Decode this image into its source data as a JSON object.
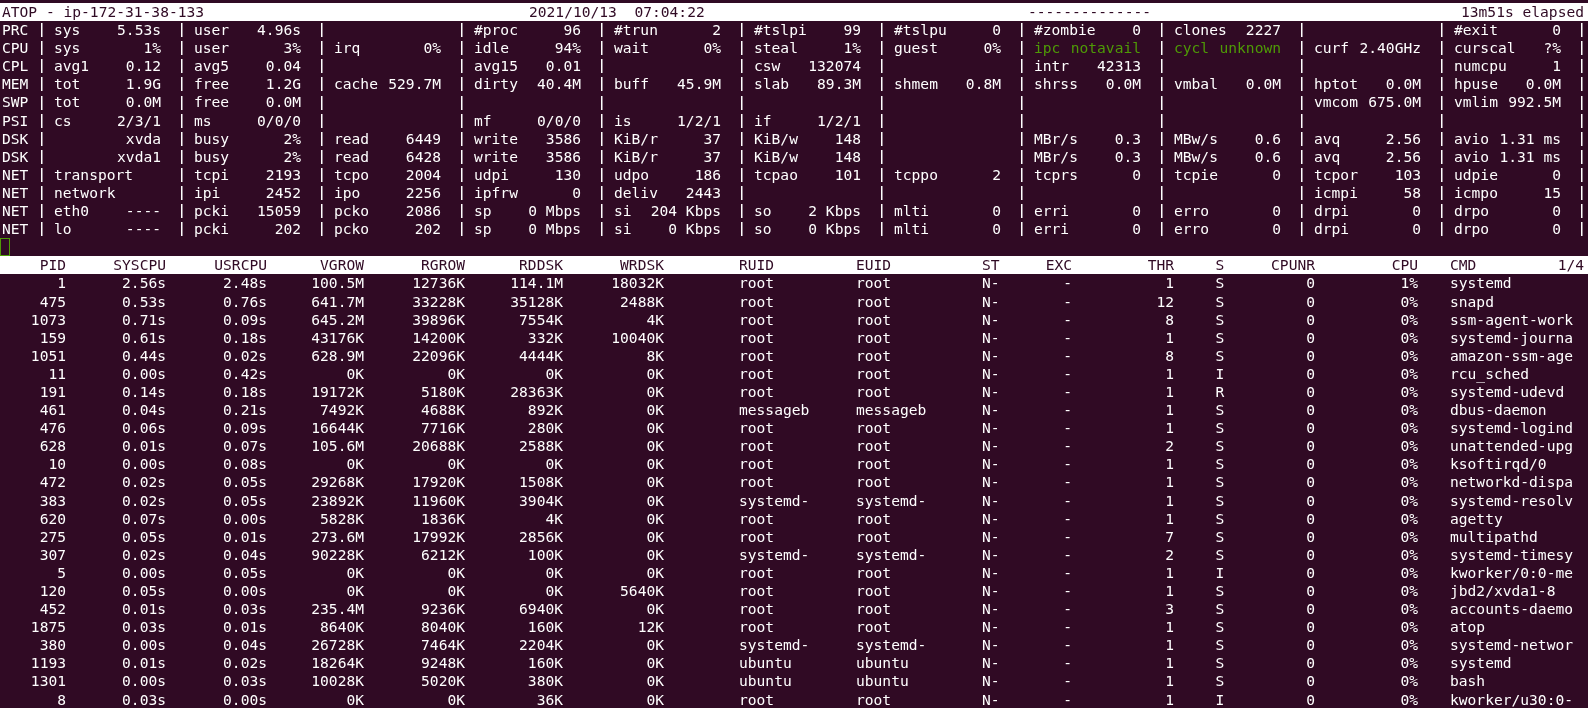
{
  "header": {
    "title": "ATOP - ip-172-31-38-133",
    "timestamp": "2021/10/13  07:04:22",
    "dashes": "--------------",
    "elapsed": "13m51s elapsed"
  },
  "system_stats": [
    {
      "label": "PRC",
      "cells": [
        {
          "k": "sys",
          "v": "5.53s"
        },
        {
          "k": "user",
          "v": "4.96s"
        },
        {},
        {
          "k": "#proc",
          "v": "96"
        },
        {
          "k": "#trun",
          "v": "2"
        },
        {
          "k": "#tslpi",
          "v": "99"
        },
        {
          "k": "#tslpu",
          "v": "0"
        },
        {
          "k": "#zombie",
          "v": "0"
        },
        {
          "k": "clones",
          "v": "2227"
        },
        {},
        {
          "k": "#exit",
          "v": "0"
        }
      ]
    },
    {
      "label": "CPU",
      "cells": [
        {
          "k": "sys",
          "v": "1%"
        },
        {
          "k": "user",
          "v": "3%"
        },
        {
          "k": "irq",
          "v": "0%"
        },
        {
          "k": "idle",
          "v": "94%"
        },
        {
          "k": "wait",
          "v": "0%"
        },
        {
          "k": "steal",
          "v": "1%"
        },
        {
          "k": "guest",
          "v": "0%"
        },
        {
          "k": "ipc",
          "v": "notavail",
          "color": "#4e9a06"
        },
        {
          "k": "cycl",
          "v": "unknown",
          "color": "#4e9a06"
        },
        {
          "k": "curf",
          "v": "2.40GHz"
        },
        {
          "k": "curscal",
          "v": "?%"
        }
      ]
    },
    {
      "label": "CPL",
      "cells": [
        {
          "k": "avg1",
          "v": "0.12"
        },
        {
          "k": "avg5",
          "v": "0.04"
        },
        {},
        {
          "k": "avg15",
          "v": "0.01"
        },
        {},
        {
          "k": "csw",
          "v": "132074"
        },
        {},
        {
          "k": "intr",
          "v": "42313"
        },
        {},
        {},
        {
          "k": "numcpu",
          "v": "1"
        }
      ]
    },
    {
      "label": "MEM",
      "cells": [
        {
          "k": "tot",
          "v": "1.9G"
        },
        {
          "k": "free",
          "v": "1.2G"
        },
        {
          "k": "cache",
          "v": "529.7M"
        },
        {
          "k": "dirty",
          "v": "40.4M"
        },
        {
          "k": "buff",
          "v": "45.9M"
        },
        {
          "k": "slab",
          "v": "89.3M"
        },
        {
          "k": "shmem",
          "v": "0.8M"
        },
        {
          "k": "shrss",
          "v": "0.0M"
        },
        {
          "k": "vmbal",
          "v": "0.0M"
        },
        {
          "k": "hptot",
          "v": "0.0M"
        },
        {
          "k": "hpuse",
          "v": "0.0M"
        }
      ]
    },
    {
      "label": "SWP",
      "cells": [
        {
          "k": "tot",
          "v": "0.0M"
        },
        {
          "k": "free",
          "v": "0.0M"
        },
        {},
        {},
        {},
        {},
        {},
        {},
        {},
        {
          "k": "vmcom",
          "v": "675.0M"
        },
        {
          "k": "vmlim",
          "v": "992.5M"
        }
      ]
    },
    {
      "label": "PSI",
      "cells": [
        {
          "k": "cs",
          "v": "2/3/1"
        },
        {
          "k": "ms",
          "v": "0/0/0"
        },
        {},
        {
          "k": "mf",
          "v": "0/0/0"
        },
        {
          "k": "is",
          "v": "1/2/1"
        },
        {
          "k": "if",
          "v": "1/2/1"
        },
        {},
        {},
        {},
        {},
        {}
      ]
    },
    {
      "label": "DSK",
      "cells": [
        {
          "v": "xvda"
        },
        {
          "k": "busy",
          "v": "2%"
        },
        {
          "k": "read",
          "v": "6449"
        },
        {
          "k": "write",
          "v": "3586"
        },
        {
          "k": "KiB/r",
          "v": "37"
        },
        {
          "k": "KiB/w",
          "v": "148"
        },
        {},
        {
          "k": "MBr/s",
          "v": "0.3"
        },
        {
          "k": "MBw/s",
          "v": "0.6"
        },
        {
          "k": "avq",
          "v": "2.56"
        },
        {
          "k": "avio",
          "v": "1.31 ms"
        }
      ]
    },
    {
      "label": "DSK",
      "cells": [
        {
          "v": "xvda1"
        },
        {
          "k": "busy",
          "v": "2%"
        },
        {
          "k": "read",
          "v": "6428"
        },
        {
          "k": "write",
          "v": "3586"
        },
        {
          "k": "KiB/r",
          "v": "37"
        },
        {
          "k": "KiB/w",
          "v": "148"
        },
        {},
        {
          "k": "MBr/s",
          "v": "0.3"
        },
        {
          "k": "MBw/s",
          "v": "0.6"
        },
        {
          "k": "avq",
          "v": "2.56"
        },
        {
          "k": "avio",
          "v": "1.31 ms"
        }
      ]
    },
    {
      "label": "NET",
      "cells": [
        {
          "k": "transport"
        },
        {
          "k": "tcpi",
          "v": "2193"
        },
        {
          "k": "tcpo",
          "v": "2004"
        },
        {
          "k": "udpi",
          "v": "130"
        },
        {
          "k": "udpo",
          "v": "186"
        },
        {
          "k": "tcpao",
          "v": "101"
        },
        {
          "k": "tcppo",
          "v": "2"
        },
        {
          "k": "tcprs",
          "v": "0"
        },
        {
          "k": "tcpie",
          "v": "0"
        },
        {
          "k": "tcpor",
          "v": "103"
        },
        {
          "k": "udpie",
          "v": "0"
        }
      ]
    },
    {
      "label": "NET",
      "cells": [
        {
          "k": "network"
        },
        {
          "k": "ipi",
          "v": "2452"
        },
        {
          "k": "ipo",
          "v": "2256"
        },
        {
          "k": "ipfrw",
          "v": "0"
        },
        {
          "k": "deliv",
          "v": "2443"
        },
        {},
        {},
        {},
        {},
        {
          "k": "icmpi",
          "v": "58"
        },
        {
          "k": "icmpo",
          "v": "15"
        }
      ]
    },
    {
      "label": "NET",
      "cells": [
        {
          "k": "eth0",
          "v": "----"
        },
        {
          "k": "pcki",
          "v": "15059"
        },
        {
          "k": "pcko",
          "v": "2086"
        },
        {
          "k": "sp",
          "v": "0 Mbps"
        },
        {
          "k": "si",
          "v": "204 Kbps"
        },
        {
          "k": "so",
          "v": "2 Kbps"
        },
        {
          "k": "mlti",
          "v": "0"
        },
        {
          "k": "erri",
          "v": "0"
        },
        {
          "k": "erro",
          "v": "0"
        },
        {
          "k": "drpi",
          "v": "0"
        },
        {
          "k": "drpo",
          "v": "0"
        }
      ]
    },
    {
      "label": "NET",
      "cells": [
        {
          "k": "lo",
          "v": "----"
        },
        {
          "k": "pcki",
          "v": "202"
        },
        {
          "k": "pcko",
          "v": "202"
        },
        {
          "k": "sp",
          "v": "0 Mbps"
        },
        {
          "k": "si",
          "v": "0 Kbps"
        },
        {
          "k": "so",
          "v": "0 Kbps"
        },
        {
          "k": "mlti",
          "v": "0"
        },
        {
          "k": "erri",
          "v": "0"
        },
        {
          "k": "erro",
          "v": "0"
        },
        {
          "k": "drpi",
          "v": "0"
        },
        {
          "k": "drpo",
          "v": "0"
        }
      ]
    }
  ],
  "process_table": {
    "columns": [
      "PID",
      "SYSCPU",
      "USRCPU",
      "VGROW",
      "RGROW",
      "RDDSK",
      "WRDSK",
      "RUID",
      "EUID",
      "ST",
      "EXC",
      "THR",
      "S",
      "CPUNR",
      "CPU",
      "CMD"
    ],
    "page": "1/4",
    "rows": [
      [
        "1",
        "2.56s",
        "2.48s",
        "100.5M",
        "12736K",
        "114.1M",
        "18032K",
        "root",
        "root",
        "N-",
        "-",
        "1",
        "S",
        "0",
        "1%",
        "systemd"
      ],
      [
        "475",
        "0.53s",
        "0.76s",
        "641.7M",
        "33228K",
        "35128K",
        "2488K",
        "root",
        "root",
        "N-",
        "-",
        "12",
        "S",
        "0",
        "0%",
        "snapd"
      ],
      [
        "1073",
        "0.71s",
        "0.09s",
        "645.2M",
        "39896K",
        "7554K",
        "4K",
        "root",
        "root",
        "N-",
        "-",
        "8",
        "S",
        "0",
        "0%",
        "ssm-agent-work"
      ],
      [
        "159",
        "0.61s",
        "0.18s",
        "43176K",
        "14200K",
        "332K",
        "10040K",
        "root",
        "root",
        "N-",
        "-",
        "1",
        "S",
        "0",
        "0%",
        "systemd-journa"
      ],
      [
        "1051",
        "0.44s",
        "0.02s",
        "628.9M",
        "22096K",
        "4444K",
        "8K",
        "root",
        "root",
        "N-",
        "-",
        "8",
        "S",
        "0",
        "0%",
        "amazon-ssm-age"
      ],
      [
        "11",
        "0.00s",
        "0.42s",
        "0K",
        "0K",
        "0K",
        "0K",
        "root",
        "root",
        "N-",
        "-",
        "1",
        "I",
        "0",
        "0%",
        "rcu_sched"
      ],
      [
        "191",
        "0.14s",
        "0.18s",
        "19172K",
        "5180K",
        "28363K",
        "0K",
        "root",
        "root",
        "N-",
        "-",
        "1",
        "R",
        "0",
        "0%",
        "systemd-udevd"
      ],
      [
        "461",
        "0.04s",
        "0.21s",
        "7492K",
        "4688K",
        "892K",
        "0K",
        "messageb",
        "messageb",
        "N-",
        "-",
        "1",
        "S",
        "0",
        "0%",
        "dbus-daemon"
      ],
      [
        "476",
        "0.06s",
        "0.09s",
        "16644K",
        "7716K",
        "280K",
        "0K",
        "root",
        "root",
        "N-",
        "-",
        "1",
        "S",
        "0",
        "0%",
        "systemd-logind"
      ],
      [
        "628",
        "0.01s",
        "0.07s",
        "105.6M",
        "20688K",
        "2588K",
        "0K",
        "root",
        "root",
        "N-",
        "-",
        "2",
        "S",
        "0",
        "0%",
        "unattended-upg"
      ],
      [
        "10",
        "0.00s",
        "0.08s",
        "0K",
        "0K",
        "0K",
        "0K",
        "root",
        "root",
        "N-",
        "-",
        "1",
        "S",
        "0",
        "0%",
        "ksoftirqd/0"
      ],
      [
        "472",
        "0.02s",
        "0.05s",
        "29268K",
        "17920K",
        "1508K",
        "0K",
        "root",
        "root",
        "N-",
        "-",
        "1",
        "S",
        "0",
        "0%",
        "networkd-dispa"
      ],
      [
        "383",
        "0.02s",
        "0.05s",
        "23892K",
        "11960K",
        "3904K",
        "0K",
        "systemd-",
        "systemd-",
        "N-",
        "-",
        "1",
        "S",
        "0",
        "0%",
        "systemd-resolv"
      ],
      [
        "620",
        "0.07s",
        "0.00s",
        "5828K",
        "1836K",
        "4K",
        "0K",
        "root",
        "root",
        "N-",
        "-",
        "1",
        "S",
        "0",
        "0%",
        "agetty"
      ],
      [
        "275",
        "0.05s",
        "0.01s",
        "273.6M",
        "17992K",
        "2856K",
        "0K",
        "root",
        "root",
        "N-",
        "-",
        "7",
        "S",
        "0",
        "0%",
        "multipathd"
      ],
      [
        "307",
        "0.02s",
        "0.04s",
        "90228K",
        "6212K",
        "100K",
        "0K",
        "systemd-",
        "systemd-",
        "N-",
        "-",
        "2",
        "S",
        "0",
        "0%",
        "systemd-timesy"
      ],
      [
        "5",
        "0.00s",
        "0.05s",
        "0K",
        "0K",
        "0K",
        "0K",
        "root",
        "root",
        "N-",
        "-",
        "1",
        "I",
        "0",
        "0%",
        "kworker/0:0-me"
      ],
      [
        "120",
        "0.05s",
        "0.00s",
        "0K",
        "0K",
        "0K",
        "5640K",
        "root",
        "root",
        "N-",
        "-",
        "1",
        "S",
        "0",
        "0%",
        "jbd2/xvda1-8"
      ],
      [
        "452",
        "0.01s",
        "0.03s",
        "235.4M",
        "9236K",
        "6940K",
        "0K",
        "root",
        "root",
        "N-",
        "-",
        "3",
        "S",
        "0",
        "0%",
        "accounts-daemo"
      ],
      [
        "1875",
        "0.03s",
        "0.01s",
        "8640K",
        "8040K",
        "160K",
        "12K",
        "root",
        "root",
        "N-",
        "-",
        "1",
        "S",
        "0",
        "0%",
        "atop"
      ],
      [
        "380",
        "0.00s",
        "0.04s",
        "26728K",
        "7464K",
        "2204K",
        "0K",
        "systemd-",
        "systemd-",
        "N-",
        "-",
        "1",
        "S",
        "0",
        "0%",
        "systemd-networ"
      ],
      [
        "1193",
        "0.01s",
        "0.02s",
        "18264K",
        "9248K",
        "160K",
        "0K",
        "ubuntu",
        "ubuntu",
        "N-",
        "-",
        "1",
        "S",
        "0",
        "0%",
        "systemd"
      ],
      [
        "1301",
        "0.00s",
        "0.03s",
        "10028K",
        "5020K",
        "380K",
        "0K",
        "ubuntu",
        "ubuntu",
        "N-",
        "-",
        "1",
        "S",
        "0",
        "0%",
        "bash"
      ],
      [
        "8",
        "0.03s",
        "0.00s",
        "0K",
        "0K",
        "36K",
        "0K",
        "root",
        "root",
        "N-",
        "-",
        "1",
        "I",
        "0",
        "0%",
        "kworker/u30:0-"
      ]
    ]
  }
}
